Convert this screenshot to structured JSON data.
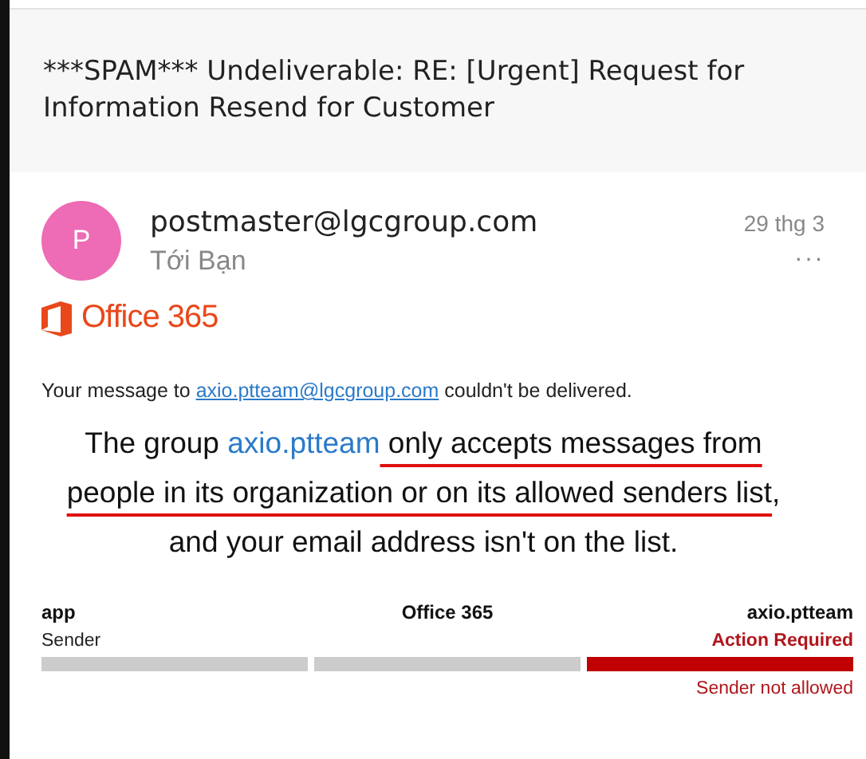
{
  "subject": "***SPAM*** Undeliverable: RE: [Urgent] Request for Information Resend for Customer",
  "message": {
    "avatar_letter": "P",
    "sender": "postmaster@lgcgroup.com",
    "recipient": "Tới Bạn",
    "date": "29 thg 3",
    "more": "···"
  },
  "brand": {
    "name": "Office 365"
  },
  "notice": {
    "before": "Your message to ",
    "link": "axio.ptteam@lgcgroup.com",
    "after": " couldn't be delivered."
  },
  "headline": {
    "lead": "The group ",
    "group_link": "axio.ptteam",
    "underlined_part": " only accepts messages from people in its organization or on its allowed senders list",
    "tail": ", and your email address isn't on the list."
  },
  "stages": [
    {
      "kind": "ok",
      "name": "app",
      "status": "Sender"
    },
    {
      "kind": "ok",
      "name": "Office 365"
    },
    {
      "kind": "error",
      "name": "axio.ptteam",
      "status": "Action Required",
      "note": "Sender not allowed"
    }
  ]
}
